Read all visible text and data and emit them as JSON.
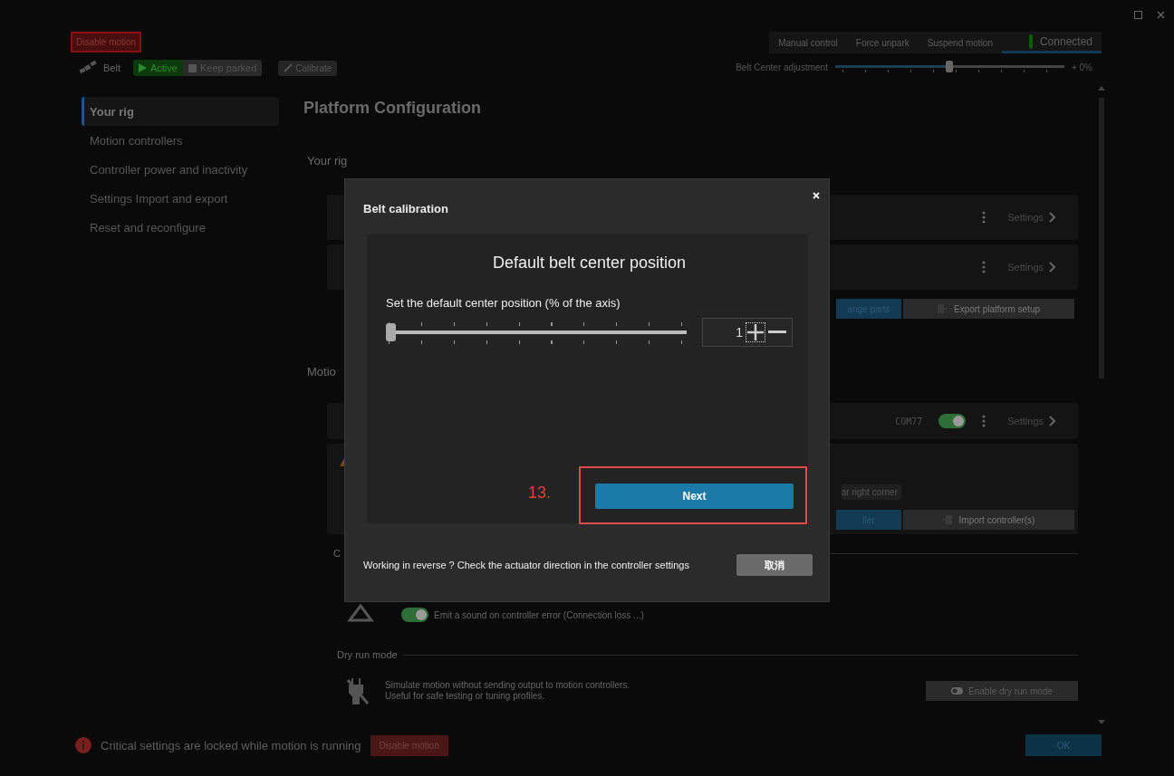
{
  "header": {
    "disable_button": "Disable motion",
    "device": "Belt",
    "modes": [
      {
        "label": "Active",
        "selected": true
      },
      {
        "label": "Keep parked",
        "selected": false
      }
    ],
    "calibrate": "Calibrate",
    "actions": [
      "Manual control",
      "Force unpark",
      "Suspend motion"
    ],
    "connection": {
      "label": "Connected",
      "connected": true
    },
    "belt_center": {
      "label": "Belt Center adjustment",
      "level": 0.5,
      "reading": "+ 0%"
    }
  },
  "sidebar": {
    "items": [
      {
        "label": "Your rig",
        "selected": true
      },
      {
        "label": "Motion controllers",
        "selected": false
      },
      {
        "label": "Controller power and inactivity",
        "selected": false
      },
      {
        "label": "Settings Import and export",
        "selected": false
      },
      {
        "label": "Reset and reconfigure",
        "selected": false
      }
    ]
  },
  "content": {
    "title": "Platform Configuration",
    "rig_heading": "Your rig",
    "rig_cards": [
      {
        "action": "Settings"
      },
      {
        "action": "Settings"
      }
    ],
    "rig_buttons": [
      "ange parts",
      "Export platform setup"
    ],
    "motion_heading": "Motio",
    "controller": {
      "port": "COM77",
      "on": true,
      "action": "Settings"
    },
    "notice_badge": "ar right corner",
    "controller_buttons": [
      "ller",
      "Import controller(s)"
    ],
    "alerts_heading": "C",
    "sound_toggle": {
      "label": "Emit a sound on controller error (Connection loss ...)",
      "on": true
    },
    "dry_run": {
      "heading": "Dry run mode",
      "description": [
        "Simulate motion without sending output to motion controllers.",
        "Useful for safe testing or tuning profiles."
      ],
      "button": "Enable dry run mode"
    }
  },
  "footer": {
    "message": "Critical settings are locked while motion is running",
    "disable_button": "Disable motion",
    "ok": "OK"
  },
  "dialog": {
    "title": "Belt calibration",
    "heading": "Default belt center position",
    "label": "Set the default center position (% of the axis)",
    "slider": {
      "level": 0.01
    },
    "value": "1",
    "next": "Next",
    "note": "Working in reverse ? Check the actuator direction in the controller settings",
    "cancel": "取消"
  },
  "annotation": {
    "step": "13."
  }
}
